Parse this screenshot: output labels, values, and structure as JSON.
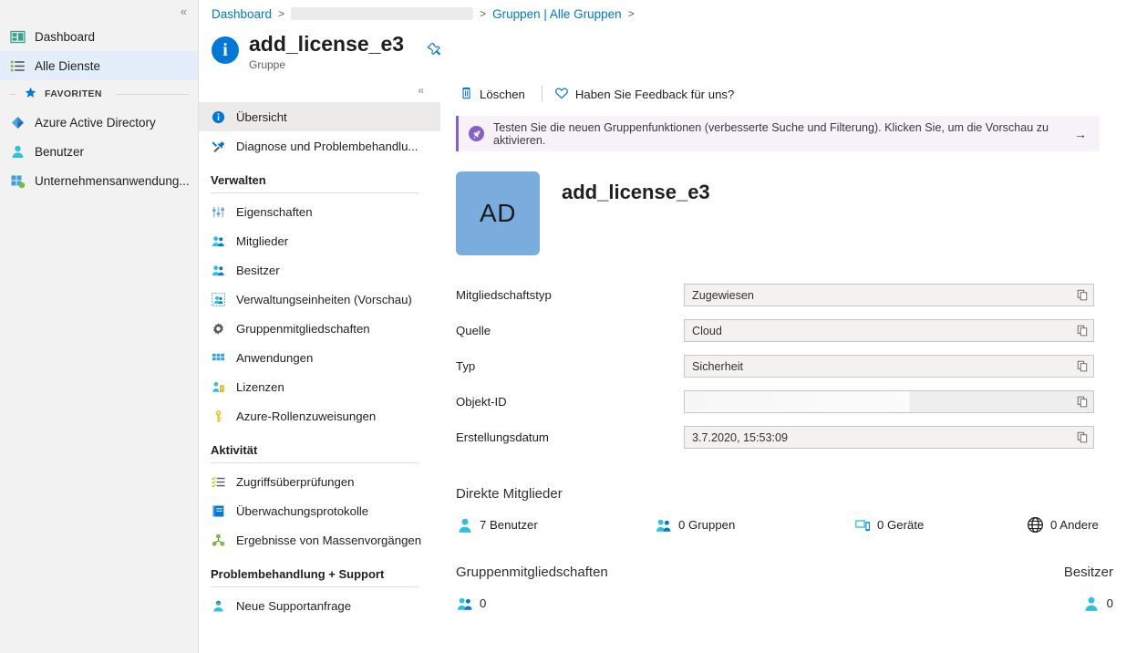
{
  "portal_sidebar": {
    "collapse_icon": "chevron-double-left-icon",
    "items": [
      {
        "label": "Dashboard",
        "icon": "dashboard-icon",
        "selected": false
      },
      {
        "label": "Alle Dienste",
        "icon": "all-services-list-icon",
        "selected": true
      }
    ],
    "favorites_header": "FAVORITEN",
    "favorites": [
      {
        "label": "Azure Active Directory",
        "icon": "azure-ad-icon"
      },
      {
        "label": "Benutzer",
        "icon": "user-icon"
      },
      {
        "label": "Unternehmensanwendung...",
        "icon": "enterprise-application-icon"
      }
    ]
  },
  "breadcrumb": {
    "items": [
      "Dashboard",
      "",
      "Gruppen | Alle Gruppen"
    ],
    "separator": ">"
  },
  "blade_header": {
    "icon": "info-circle-icon",
    "title": "add_license_e3",
    "subtitle": "Gruppe",
    "pin_icon": "pin-icon"
  },
  "blade_menu": {
    "collapse_icon": "chevron-double-left-icon",
    "top_items": [
      {
        "label": "Übersicht",
        "icon": "info-circle-icon",
        "active": true
      },
      {
        "label": "Diagnose und Problembehandlu...",
        "icon": "diagnose-tools-icon",
        "active": false
      }
    ],
    "groups": [
      {
        "title": "Verwalten",
        "items": [
          {
            "label": "Eigenschaften",
            "icon": "properties-sliders-icon"
          },
          {
            "label": "Mitglieder",
            "icon": "members-group-icon"
          },
          {
            "label": "Besitzer",
            "icon": "owners-group-icon"
          },
          {
            "label": "Verwaltungseinheiten (Vorschau)",
            "icon": "administrative-units-icon"
          },
          {
            "label": "Gruppenmitgliedschaften",
            "icon": "gear-icon"
          },
          {
            "label": "Anwendungen",
            "icon": "applications-grid-icon"
          },
          {
            "label": "Lizenzen",
            "icon": "licenses-icon"
          },
          {
            "label": "Azure-Rollenzuweisungen",
            "icon": "key-icon"
          }
        ]
      },
      {
        "title": "Aktivität",
        "items": [
          {
            "label": "Zugriffsüberprüfungen",
            "icon": "access-reviews-checklist-icon"
          },
          {
            "label": "Überwachungsprotokolle",
            "icon": "audit-logs-book-icon"
          },
          {
            "label": "Ergebnisse von Massenvorgängen",
            "icon": "bulk-operation-results-icon"
          }
        ]
      },
      {
        "title": "Problembehandlung + Support",
        "items": [
          {
            "label": "Neue Supportanfrage",
            "icon": "support-request-icon"
          }
        ]
      }
    ]
  },
  "command_bar": {
    "delete": {
      "label": "Löschen",
      "icon": "trash-icon"
    },
    "feedback": {
      "label": "Haben Sie Feedback für uns?",
      "icon": "heart-icon"
    }
  },
  "banner": {
    "icon": "rocket-icon",
    "text": "Testen Sie die neuen Gruppenfunktionen (verbesserte Suche und Filterung). Klicken Sie, um die Vorschau zu aktivieren.",
    "arrow": "→",
    "accent_color": "#8661c5",
    "background_color": "#f7f2f9"
  },
  "group": {
    "avatar_initials": "AD",
    "avatar_color": "#7aadde",
    "name": "add_license_e3"
  },
  "properties": [
    {
      "label": "Mitgliedschaftstyp",
      "value": "Zugewiesen",
      "redacted": false,
      "copy_icon": "copy-icon"
    },
    {
      "label": "Quelle",
      "value": "Cloud",
      "redacted": false,
      "copy_icon": "copy-icon"
    },
    {
      "label": "Typ",
      "value": "Sicherheit",
      "redacted": false,
      "copy_icon": "copy-icon"
    },
    {
      "label": "Objekt-ID",
      "value": "",
      "redacted": true,
      "copy_icon": "copy-icon"
    },
    {
      "label": "Erstellungsdatum",
      "value": "3.7.2020, 15:53:09",
      "redacted": false,
      "copy_icon": "copy-icon"
    }
  ],
  "direct_members": {
    "title": "Direkte Mitglieder",
    "counts": [
      {
        "label": "7 Benutzer",
        "icon": "user-icon"
      },
      {
        "label": "0 Gruppen",
        "icon": "group-icon"
      },
      {
        "label": "0 Geräte",
        "icon": "device-icon"
      },
      {
        "label": "0 Andere",
        "icon": "globe-icon"
      }
    ]
  },
  "bottom": {
    "memberships_title": "Gruppenmitgliedschaften",
    "memberships_count": "0",
    "memberships_icon": "group-icon",
    "owners_title": "Besitzer",
    "owners_count": "0",
    "owners_icon": "user-icon"
  }
}
